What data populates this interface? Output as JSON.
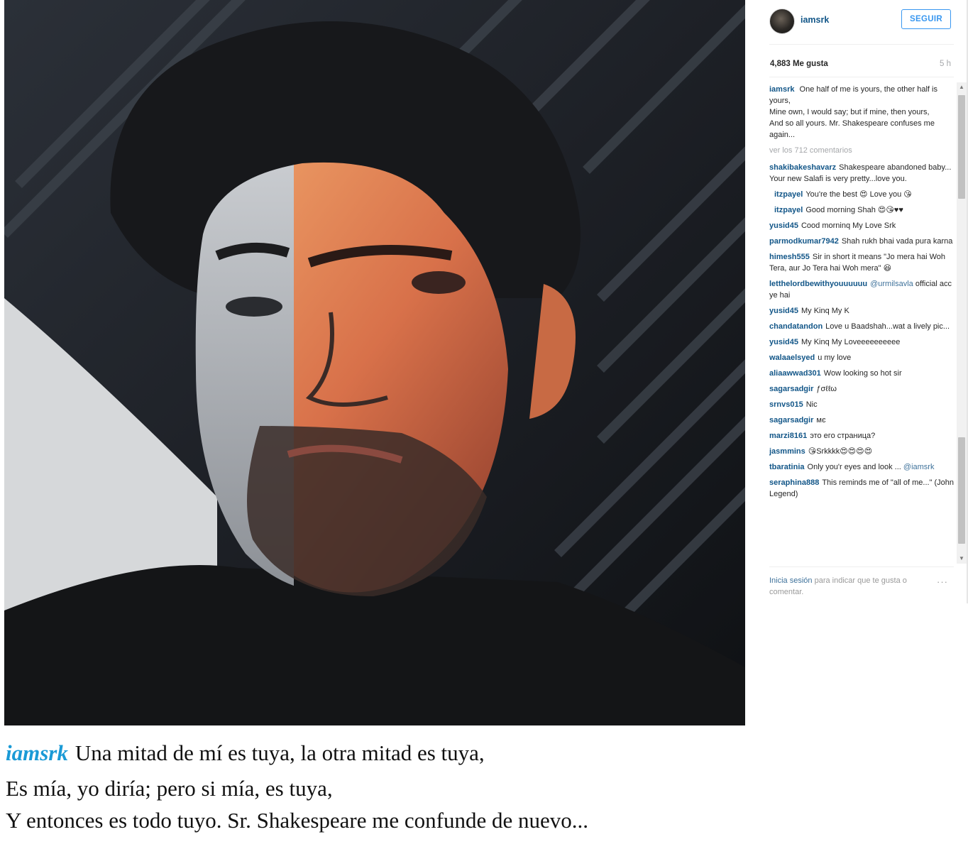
{
  "post": {
    "username": "iamsrk",
    "follow_label": "SEGUIR",
    "likes": "4,883 Me gusta",
    "time": "5 h",
    "caption": {
      "user": "iamsrk",
      "text": "One half of me is yours, the other half is yours,\nMine own, I would say; but if mine, then yours,\nAnd so all yours. Mr. Shakespeare confuses me again..."
    },
    "view_all": "ver los 712 comentarios",
    "comments": [
      {
        "user": "shakibakeshavarz",
        "text": "Shakespeare abandoned baby... Your new Salafi is very pretty...love you.",
        "reply": false
      },
      {
        "user": "itzpayel",
        "text": "You're the best 😍 Love you 😘",
        "reply": true
      },
      {
        "user": "itzpayel",
        "text": "Good morning Shah 😍😘♥♥",
        "reply": true
      },
      {
        "user": "yusid45",
        "text": "Cood morninq My Love Srk",
        "reply": false
      },
      {
        "user": "parmodkumar7942",
        "text": "Shah rukh bhai vada pura karna",
        "reply": false
      },
      {
        "user": "himesh555",
        "text": "Sir in short it means \"Jo mera hai Woh Tera, aur Jo Tera hai Woh mera\" 😆",
        "reply": false
      },
      {
        "user": "letthelordbewithyouuuuuu",
        "text": "",
        "mention": "@urmilsavla",
        "after": "official acc ye hai",
        "reply": false
      },
      {
        "user": "yusid45",
        "text": "My Kinq My K",
        "reply": false
      },
      {
        "user": "chandatandon",
        "text": "Love u Baadshah...wat a lively pic...",
        "reply": false
      },
      {
        "user": "yusid45",
        "text": "My Kinq My Loveeeeeeeeee",
        "reply": false
      },
      {
        "user": "walaaelsyed",
        "text": "u my love",
        "reply": false
      },
      {
        "user": "aliaawwad301",
        "text": "Wow looking so hot sir",
        "reply": false
      },
      {
        "user": "sagarsadgir",
        "text": "ƒσℓℓω",
        "reply": false
      },
      {
        "user": "srnvs015",
        "text": "Nic",
        "reply": false
      },
      {
        "user": "sagarsadgir",
        "text": "мє",
        "reply": false
      },
      {
        "user": "marzi8161",
        "text": "это его страница?",
        "reply": false
      },
      {
        "user": "jasmmins",
        "text": "😘Srkkkk😍😍😍😍",
        "reply": false
      },
      {
        "user": "tbaratinia",
        "text": "Only you'r eyes and look ...",
        "mention": "@iamsrk",
        "after": "",
        "reply": false
      },
      {
        "user": "seraphina888",
        "text": "This reminds me of \"all of me...\" (John Legend)",
        "reply": false
      }
    ],
    "login_link": "Inicia sesión",
    "login_text": "para indicar que te gusta o comentar.",
    "more_icon": "···"
  },
  "translation": {
    "user": "iamsrk",
    "line1": "Una mitad de mí es tuya, la otra mitad es tuya,",
    "line2": "Es mía, yo diría; pero si mía, es tuya,",
    "line3": "Y entonces es todo tuyo. Sr. Shakespeare me confunde de nuevo..."
  },
  "colors": {
    "username": "#125688",
    "follow": "#3897f0",
    "translation_user": "#1a9ad6"
  }
}
